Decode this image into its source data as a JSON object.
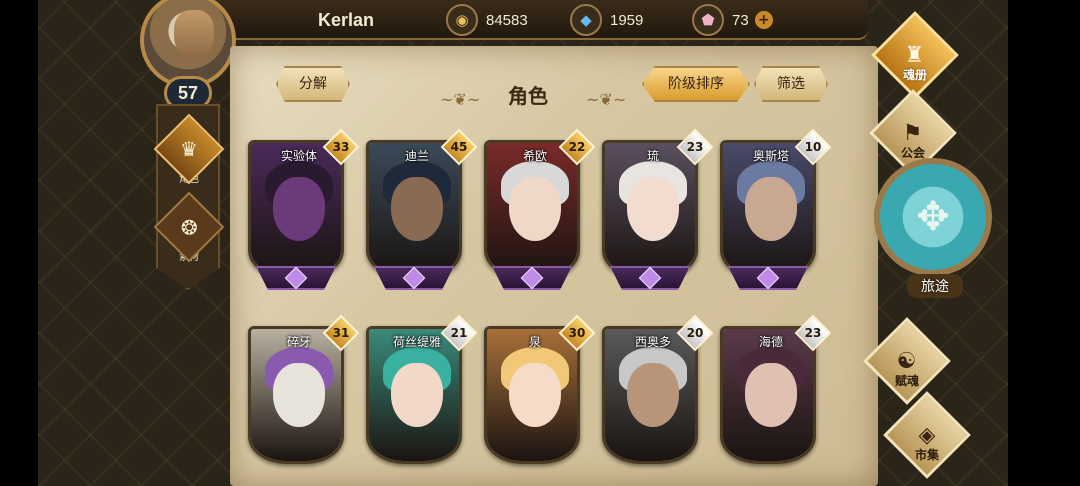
{
  "player": {
    "name": "Kerlan",
    "level": "57"
  },
  "currencies": [
    {
      "icon": "gold-coin-icon",
      "value": "84583"
    },
    {
      "icon": "blue-crystal-icon",
      "value": "1959"
    },
    {
      "icon": "pink-gem-icon",
      "value": "73",
      "plus": "+"
    }
  ],
  "side_tabs": [
    {
      "label": "角色",
      "icon": "character-icon",
      "active": true
    },
    {
      "label": "素材",
      "icon": "material-icon",
      "active": false
    }
  ],
  "toolbar": {
    "decompose": "分解",
    "title": "角色",
    "sort": "阶级排序",
    "filter": "筛选"
  },
  "characters": [
    {
      "name": "实验体",
      "level": "33",
      "tag": "gold",
      "palette": [
        "#4a2a5a",
        "#6a3a7a",
        "#2a1a30"
      ]
    },
    {
      "name": "迪兰",
      "level": "45",
      "tag": "gold",
      "palette": [
        "#3a4a5a",
        "#8a6a52",
        "#1e2a3a"
      ]
    },
    {
      "name": "希欧",
      "level": "22",
      "tag": "gold",
      "palette": [
        "#7a2a2a",
        "#f0d8c8",
        "#d8d8d8"
      ]
    },
    {
      "name": "琉",
      "level": "23",
      "tag": "silver",
      "palette": [
        "#5a5060",
        "#f2dcd0",
        "#e8e4e0"
      ]
    },
    {
      "name": "奥斯塔",
      "level": "10",
      "tag": "silver",
      "palette": [
        "#4a4a6a",
        "#c8a890",
        "#6a7aa0"
      ]
    },
    {
      "name": "碎牙",
      "level": "31",
      "tag": "gold",
      "palette": [
        "#b8b0a0",
        "#e8e4dc",
        "#8a5ab0"
      ]
    },
    {
      "name": "荷丝缇雅",
      "level": "21",
      "tag": "silver",
      "palette": [
        "#3a8a7a",
        "#f2d8c8",
        "#3ab0a0"
      ]
    },
    {
      "name": "泉",
      "level": "30",
      "tag": "gold",
      "palette": [
        "#a8703a",
        "#f6dcc8",
        "#f0c878"
      ]
    },
    {
      "name": "西奥多",
      "level": "20",
      "tag": "silver",
      "palette": [
        "#5a5a5a",
        "#b89478",
        "#c8c8c8"
      ]
    },
    {
      "name": "海德",
      "level": "23",
      "tag": "silver",
      "palette": [
        "#5a3a4a",
        "#e0c0b0",
        "#4a2a3a"
      ]
    }
  ],
  "right_nav": [
    {
      "label": "魂册",
      "icon": "soul-book-icon"
    },
    {
      "label": "公会",
      "icon": "guild-icon"
    },
    {
      "label": "旅途",
      "icon": "journey-icon"
    },
    {
      "label": "赋魂",
      "icon": "soul-infuse-icon"
    },
    {
      "label": "市集",
      "icon": "market-icon"
    }
  ]
}
